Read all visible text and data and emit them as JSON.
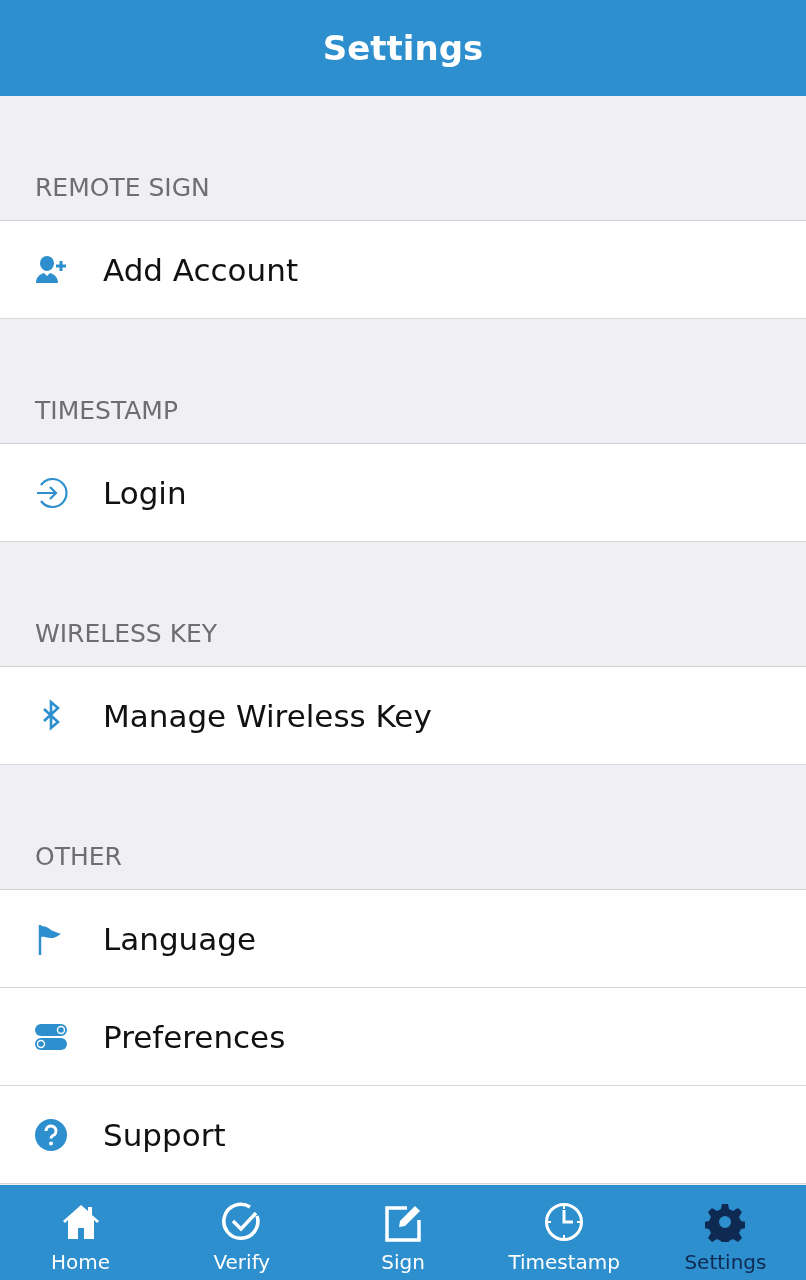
{
  "header": {
    "title": "Settings"
  },
  "sections": [
    {
      "title": "REMOTE SIGN",
      "items": [
        {
          "label": "Add Account"
        }
      ]
    },
    {
      "title": "TIMESTAMP",
      "items": [
        {
          "label": "Login"
        }
      ]
    },
    {
      "title": "WIRELESS KEY",
      "items": [
        {
          "label": "Manage Wireless Key"
        }
      ]
    },
    {
      "title": "OTHER",
      "items": [
        {
          "label": "Language"
        },
        {
          "label": "Preferences"
        },
        {
          "label": "Support"
        }
      ]
    }
  ],
  "tabs": [
    {
      "label": "Home",
      "selected": false
    },
    {
      "label": "Verify",
      "selected": false
    },
    {
      "label": "Sign",
      "selected": false
    },
    {
      "label": "Timestamp",
      "selected": false
    },
    {
      "label": "Settings",
      "selected": true
    }
  ]
}
